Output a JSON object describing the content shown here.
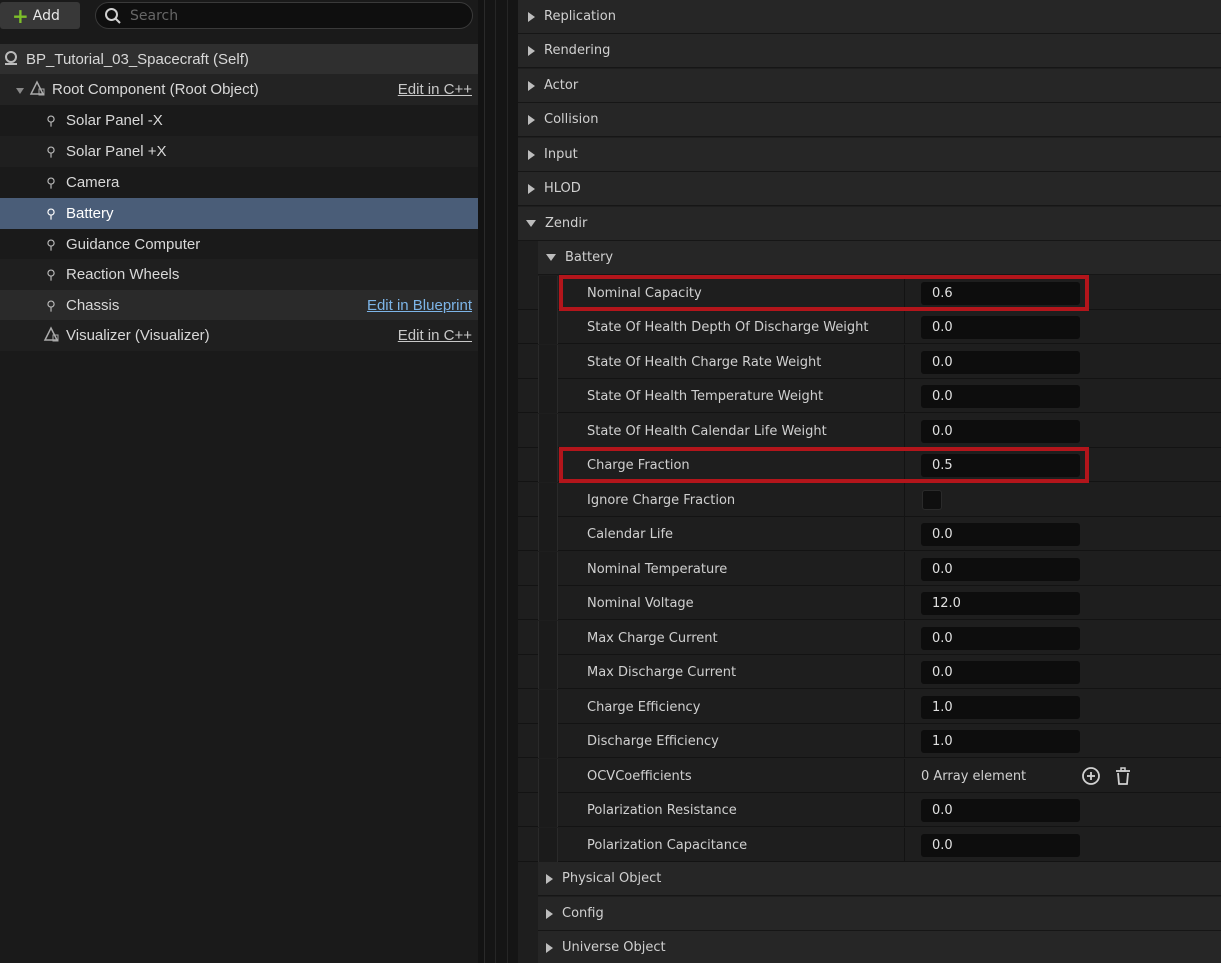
{
  "toolbar": {
    "add_label": "Add",
    "search_placeholder": "Search"
  },
  "tree": {
    "root_self": "BP_Tutorial_03_Spacecraft (Self)",
    "root_component": {
      "label": "Root Component (Root Object)",
      "edit": "Edit in C++"
    },
    "items": [
      {
        "label": "Solar Panel -X"
      },
      {
        "label": "Solar Panel +X"
      },
      {
        "label": "Camera"
      },
      {
        "label": "Battery"
      },
      {
        "label": "Guidance Computer"
      },
      {
        "label": "Reaction Wheels"
      },
      {
        "label": "Chassis",
        "edit": "Edit in Blueprint"
      }
    ],
    "visualizer": {
      "label": "Visualizer (Visualizer)",
      "edit": "Edit in C++"
    },
    "selected": "Battery"
  },
  "details": {
    "categories": [
      "Replication",
      "Rendering",
      "Actor",
      "Collision",
      "Input",
      "HLOD"
    ],
    "zendir": "Zendir",
    "battery_section": "Battery",
    "properties": [
      {
        "label": "Nominal Capacity",
        "value": "0.6"
      },
      {
        "label": "State Of Health Depth Of Discharge Weight",
        "value": "0.0"
      },
      {
        "label": "State Of Health Charge Rate Weight",
        "value": "0.0"
      },
      {
        "label": "State Of Health Temperature Weight",
        "value": "0.0"
      },
      {
        "label": "State Of Health Calendar Life Weight",
        "value": "0.0"
      },
      {
        "label": "Charge Fraction",
        "value": "0.5"
      },
      {
        "label": "Ignore Charge Fraction",
        "checked": false
      },
      {
        "label": "Calendar Life",
        "value": "0.0"
      },
      {
        "label": "Nominal Temperature",
        "value": "0.0"
      },
      {
        "label": "Nominal Voltage",
        "value": "12.0"
      },
      {
        "label": "Max Charge Current",
        "value": "0.0"
      },
      {
        "label": "Max Discharge Current",
        "value": "0.0"
      },
      {
        "label": "Charge Efficiency",
        "value": "1.0"
      },
      {
        "label": "Discharge Efficiency",
        "value": "1.0"
      },
      {
        "label": "OCVCoefficients",
        "value": "0 Array element"
      },
      {
        "label": "Polarization Resistance",
        "value": "0.0"
      },
      {
        "label": "Polarization Capacitance",
        "value": "0.0"
      }
    ],
    "sub_categories": [
      "Physical Object",
      "Config",
      "Universe Object"
    ]
  },
  "colors": {
    "highlight": "#b3151b",
    "selected_row": "#4a5d78",
    "add_plus": "#7dbf2a",
    "blueprint_link": "#7db5e8"
  }
}
